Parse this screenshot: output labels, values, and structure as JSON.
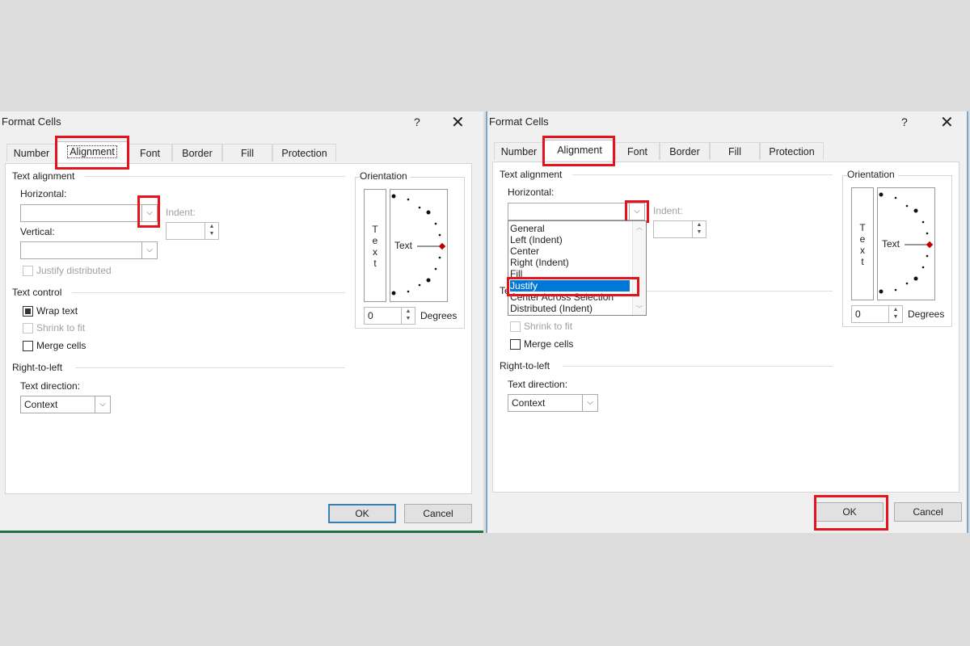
{
  "dialog": {
    "title": "Format Cells",
    "help": "?",
    "close": "✕",
    "tabs": [
      "Number",
      "Alignment",
      "Font",
      "Border",
      "Fill",
      "Protection"
    ],
    "text_alignment": "Text alignment",
    "horizontal": "Horizontal:",
    "indent": "Indent:",
    "vertical": "Vertical:",
    "justify_distributed": "Justify distributed",
    "text_control": "Text control",
    "wrap_text": "Wrap text",
    "shrink_to_fit": "Shrink to fit",
    "merge_cells": "Merge cells",
    "right_to_left": "Right-to-left",
    "text_direction": "Text direction:",
    "direction_value": "Context",
    "orientation": "Orientation",
    "vertical_text": [
      "T",
      "e",
      "x",
      "t"
    ],
    "orientation_text": "Text",
    "degrees_value": "0",
    "degrees": "Degrees",
    "ok": "OK",
    "cancel": "Cancel"
  },
  "horizontal_options": [
    "General",
    "Left (Indent)",
    "Center",
    "Right (Indent)",
    "Fill",
    "Justify",
    "Center Across Selection",
    "Distributed (Indent)"
  ],
  "selected_option": "Justify",
  "highlight_color": "#e3141b",
  "selection_color": "#0078d7"
}
